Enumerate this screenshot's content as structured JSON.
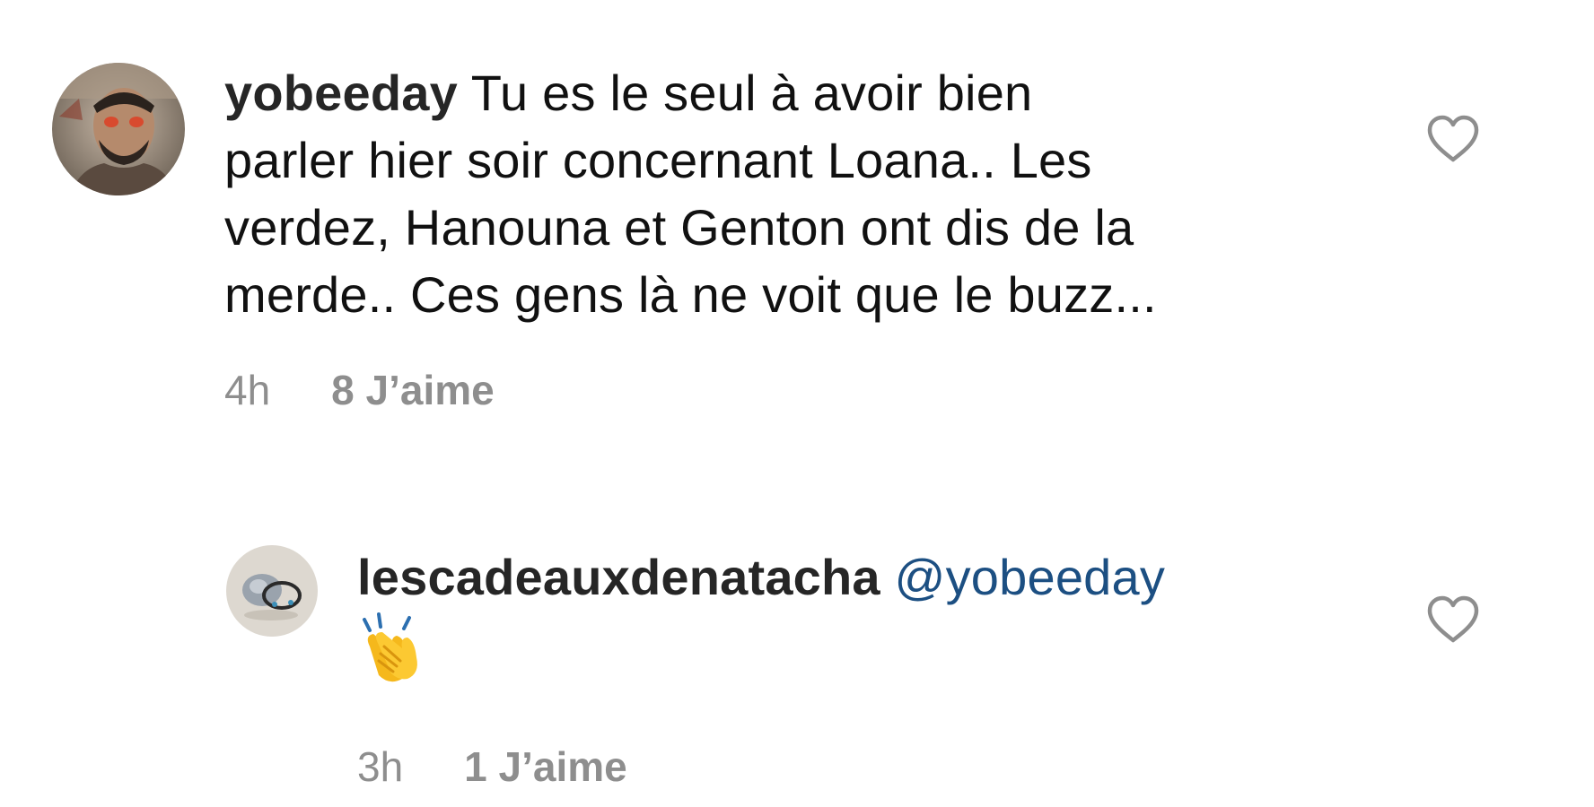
{
  "comments": [
    {
      "username": "yobeeday",
      "text_lines": [
        "Tu es le seul à avoir bien",
        "parler hier soir concernant Loana.. Les",
        "verdez, Hanouna et Genton ont dis de la",
        "merde.. Ces gens là ne voit que le buzz..."
      ],
      "time": "4h",
      "likes": "8 J’aime",
      "like_icon": "heart-outline-icon"
    },
    {
      "username": "lescadeauxdenatacha",
      "mention": "@yobeeday",
      "emoji": "👏",
      "emoji_name": "clapping-hands-emoji",
      "time": "3h",
      "likes": "1 J’aime",
      "like_icon": "heart-outline-icon"
    }
  ],
  "colors": {
    "username": "#262626",
    "text": "#111111",
    "mention": "#1c4f82",
    "meta": "#8e8e8e",
    "heart_stroke": "#8e8e8e"
  }
}
